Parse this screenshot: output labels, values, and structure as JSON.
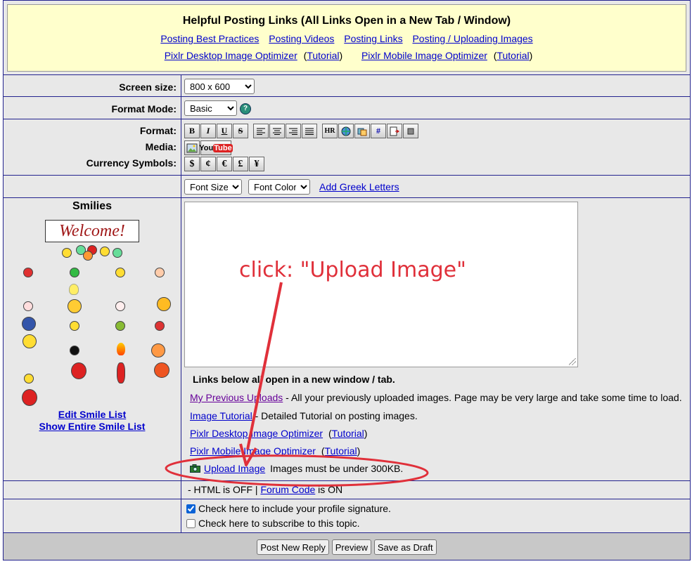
{
  "header": {
    "title": "Helpful Posting Links (All Links Open in a New Tab / Window)",
    "links_row1": [
      "Posting Best Practices",
      "Posting Videos",
      "Posting Links",
      "Posting / Uploading Images"
    ],
    "pixlr_desktop": "Pixlr Desktop Image Optimizer",
    "pixlr_mobile": "Pixlr Mobile Image Optimizer",
    "tutorial": "Tutorial",
    "open_paren": "(",
    "close_paren": ")"
  },
  "screen_size": {
    "label": "Screen size:",
    "value": "800 x 600"
  },
  "format_mode": {
    "label": "Format Mode:",
    "value": "Basic",
    "help_icon": "help-icon"
  },
  "toolbar": {
    "format_label": "Format:",
    "media_label": "Media:",
    "currency_label": "Currency Symbols:",
    "format_buttons": [
      "B",
      "I",
      "U",
      "S",
      "align-left",
      "align-center",
      "align-right",
      "justify",
      "HR",
      "globe",
      "link",
      "#",
      "quote",
      "square"
    ],
    "youtube": "YouTube",
    "currency": [
      "$",
      "¢",
      "€",
      "£",
      "¥"
    ]
  },
  "font": {
    "size": "Font Size",
    "color": "Font Color",
    "greek": "Add Greek Letters"
  },
  "smilies": {
    "title": "Smilies",
    "welcome": "Welcome!",
    "edit": "Edit Smile List",
    "show": "Show Entire Smile List"
  },
  "links_area": {
    "heading": "Links below all open in a new window / tab.",
    "prev_uploads": "My Previous Uploads",
    "prev_uploads_desc": " - All your previously uploaded images. Page may be very large and take some time to load.",
    "image_tutorial": "Image Tutorial",
    "image_tutorial_desc": " - Detailed Tutorial on posting images.",
    "pixlr_desktop": "Pixlr Desktop Image Optimizer",
    "pixlr_mobile": "Pixlr Mobile Image Optimizer",
    "tutorial": "Tutorial",
    "upload_image": "Upload Image",
    "upload_note": "Images must be under 300KB."
  },
  "html_status": {
    "prefix": "-  HTML is OFF | ",
    "forum_code": "Forum Code",
    "suffix": " is ON"
  },
  "options": {
    "signature": "Check here to include your profile signature.",
    "signature_checked": true,
    "subscribe": "Check here to subscribe to this topic.",
    "subscribe_checked": false
  },
  "actions": {
    "post": "Post New Reply",
    "preview": "Preview",
    "draft": "Save as Draft"
  },
  "annotation": {
    "text": "click: \"Upload Image\"",
    "color": "#e0303a"
  }
}
